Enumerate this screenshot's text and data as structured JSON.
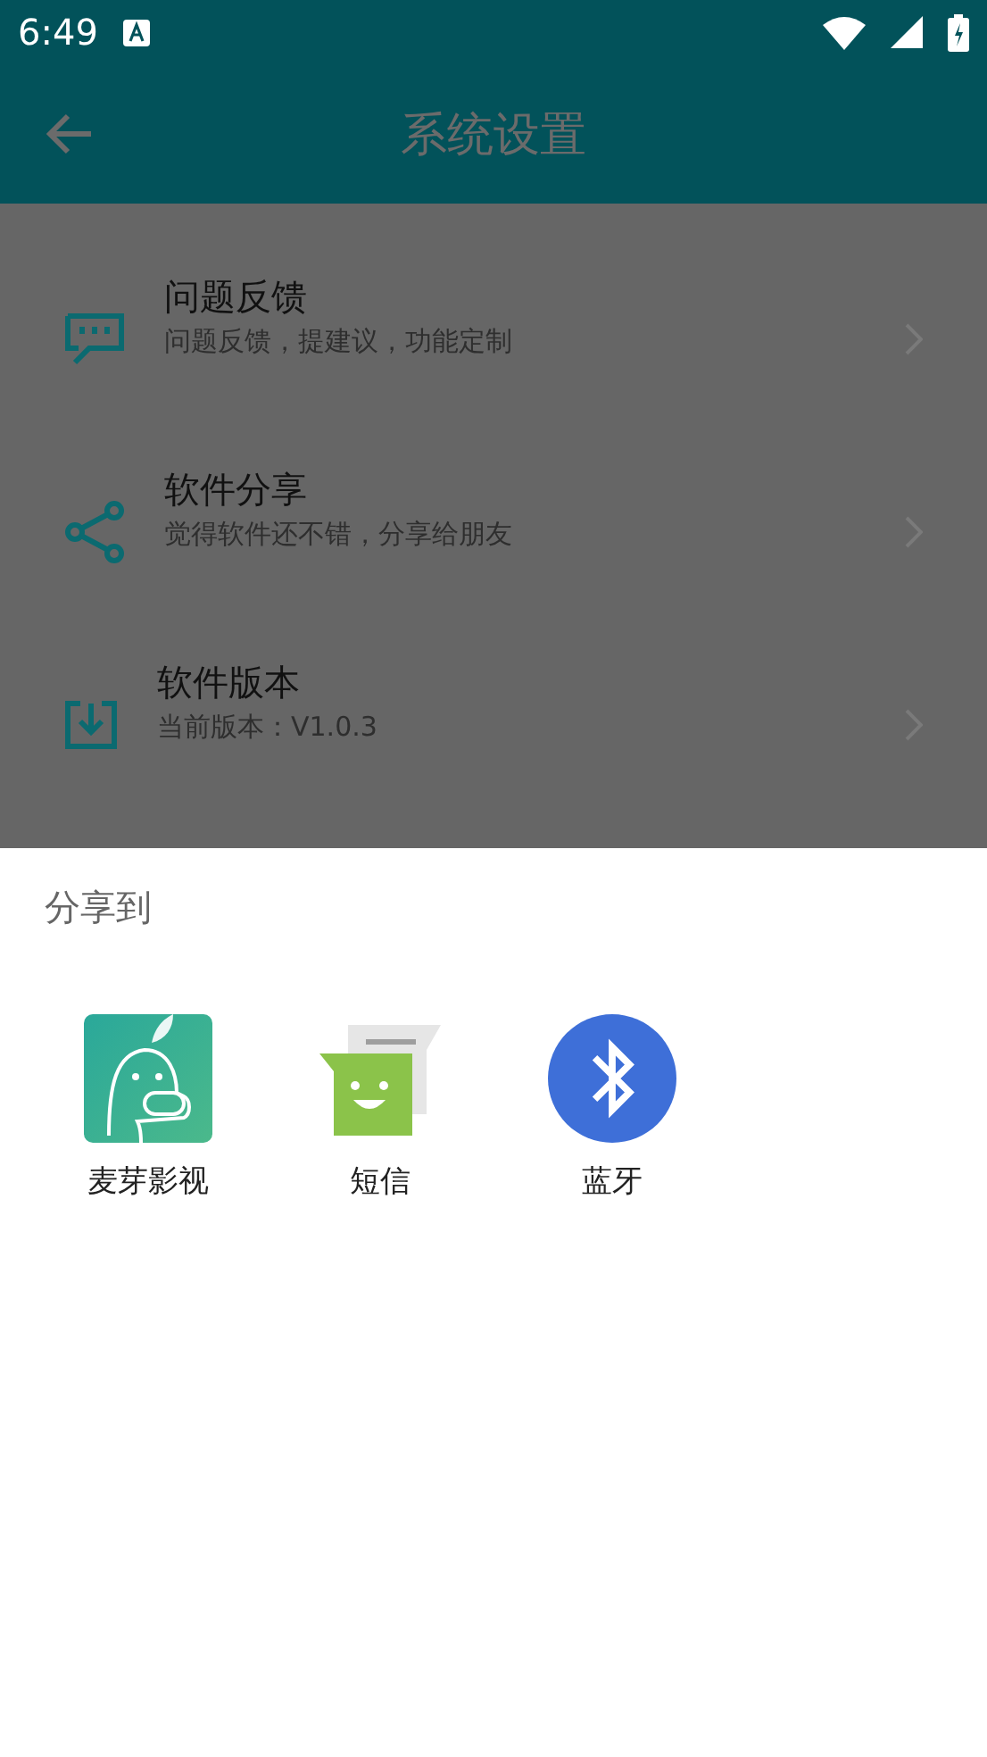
{
  "status_bar": {
    "time": "6:49"
  },
  "toolbar": {
    "title": "系统设置"
  },
  "settings": [
    {
      "title": "问题反馈",
      "subtitle": "问题反馈，提建议，功能定制"
    },
    {
      "title": "软件分享",
      "subtitle": "觉得软件还不错，分享给朋友"
    },
    {
      "title": "软件版本",
      "subtitle": "当前版本：V1.0.3"
    }
  ],
  "share_sheet": {
    "title": "分享到",
    "targets": [
      {
        "label": "麦芽影视"
      },
      {
        "label": "短信"
      },
      {
        "label": "蓝牙"
      }
    ]
  }
}
